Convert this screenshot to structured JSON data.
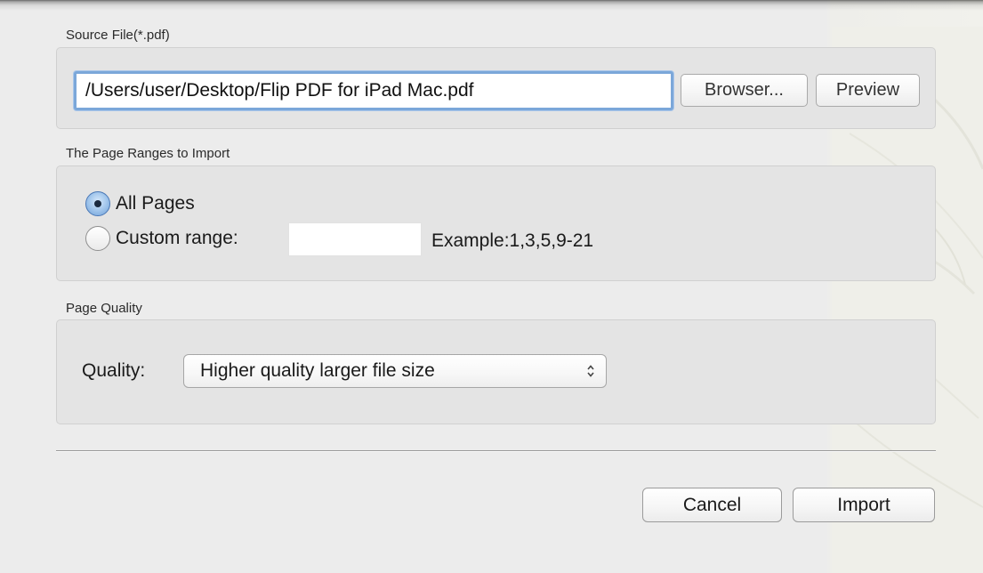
{
  "source_file": {
    "section_label": "Source File(*.pdf)",
    "path_value": "/Users/user/Desktop/Flip PDF for iPad Mac.pdf",
    "browse_label": "Browser...",
    "preview_label": "Preview"
  },
  "page_ranges": {
    "section_label": "The Page Ranges to Import",
    "all_pages_label": "All Pages",
    "custom_range_label": "Custom range:",
    "custom_range_value": "",
    "example_text": "Example:1,3,5,9-21",
    "selected": "all_pages"
  },
  "page_quality": {
    "section_label": "Page Quality",
    "quality_label": "Quality:",
    "selected_option": "Higher quality larger file size"
  },
  "footer": {
    "cancel_label": "Cancel",
    "import_label": "Import"
  },
  "colors": {
    "focus_ring": "#7ba7d9",
    "radio_selected": "#6f9fd6",
    "dialog_background": "#ececec",
    "group_background": "#e4e4e4"
  },
  "icons": {
    "select_arrows": "updown-chevron-icon"
  }
}
